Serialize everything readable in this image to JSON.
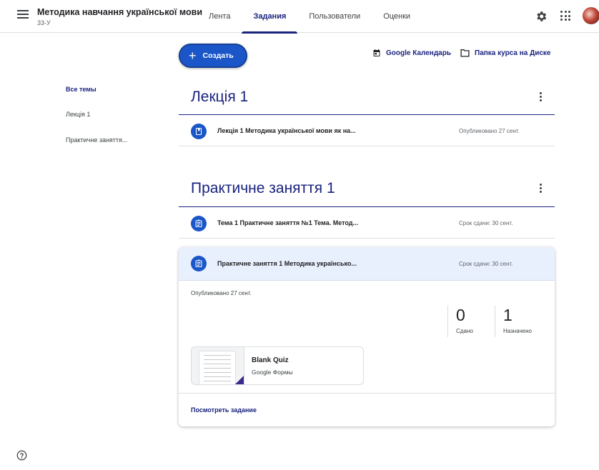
{
  "header": {
    "course_title": "Методика навчання української мови",
    "course_section": "33-У",
    "tabs": [
      {
        "label": "Лента"
      },
      {
        "label": "Задания"
      },
      {
        "label": "Пользователи"
      },
      {
        "label": "Оценки"
      }
    ],
    "active_tab": "Задания",
    "icons": [
      "menu-icon",
      "gear-icon",
      "apps-grid-icon",
      "avatar"
    ]
  },
  "toolbar": {
    "create_label": "Создать",
    "calendar_label": "Google Календарь",
    "drive_label": "Папка курса на Диске"
  },
  "sidebar": {
    "items": [
      {
        "label": "Все темы",
        "active": true
      },
      {
        "label": "Лекція 1",
        "active": false
      },
      {
        "label": "Практичне заняття...",
        "active": false
      }
    ]
  },
  "topics": [
    {
      "title": "Лекція 1",
      "items": [
        {
          "icon": "material-icon",
          "title": "Лекція 1 Методика української мови як на...",
          "meta": "Опубликовано 27 сент."
        }
      ]
    },
    {
      "title": "Практичне заняття 1",
      "items": [
        {
          "icon": "assignment-icon",
          "title": "Тема 1 Практичне заняття №1 Тема. Метод...",
          "meta": "Срок сдачи: 30 сент."
        }
      ],
      "expanded_item": {
        "icon": "assignment-icon",
        "title": "Практичне заняття 1 Методика українсько...",
        "meta": "Срок сдачи: 30 сент.",
        "published": "Опубликовано 27 сент.",
        "stats": [
          {
            "num": "0",
            "label": "Сдано"
          },
          {
            "num": "1",
            "label": "Назначено"
          }
        ],
        "attachment": {
          "title": "Blank Quiz",
          "subtitle": "Google Формы"
        },
        "view_link": "Посмотреть задание"
      }
    }
  ],
  "colors": {
    "accent": "#1a237e",
    "button": "#1a56c8",
    "expanded_bg": "#e8f0fe"
  }
}
